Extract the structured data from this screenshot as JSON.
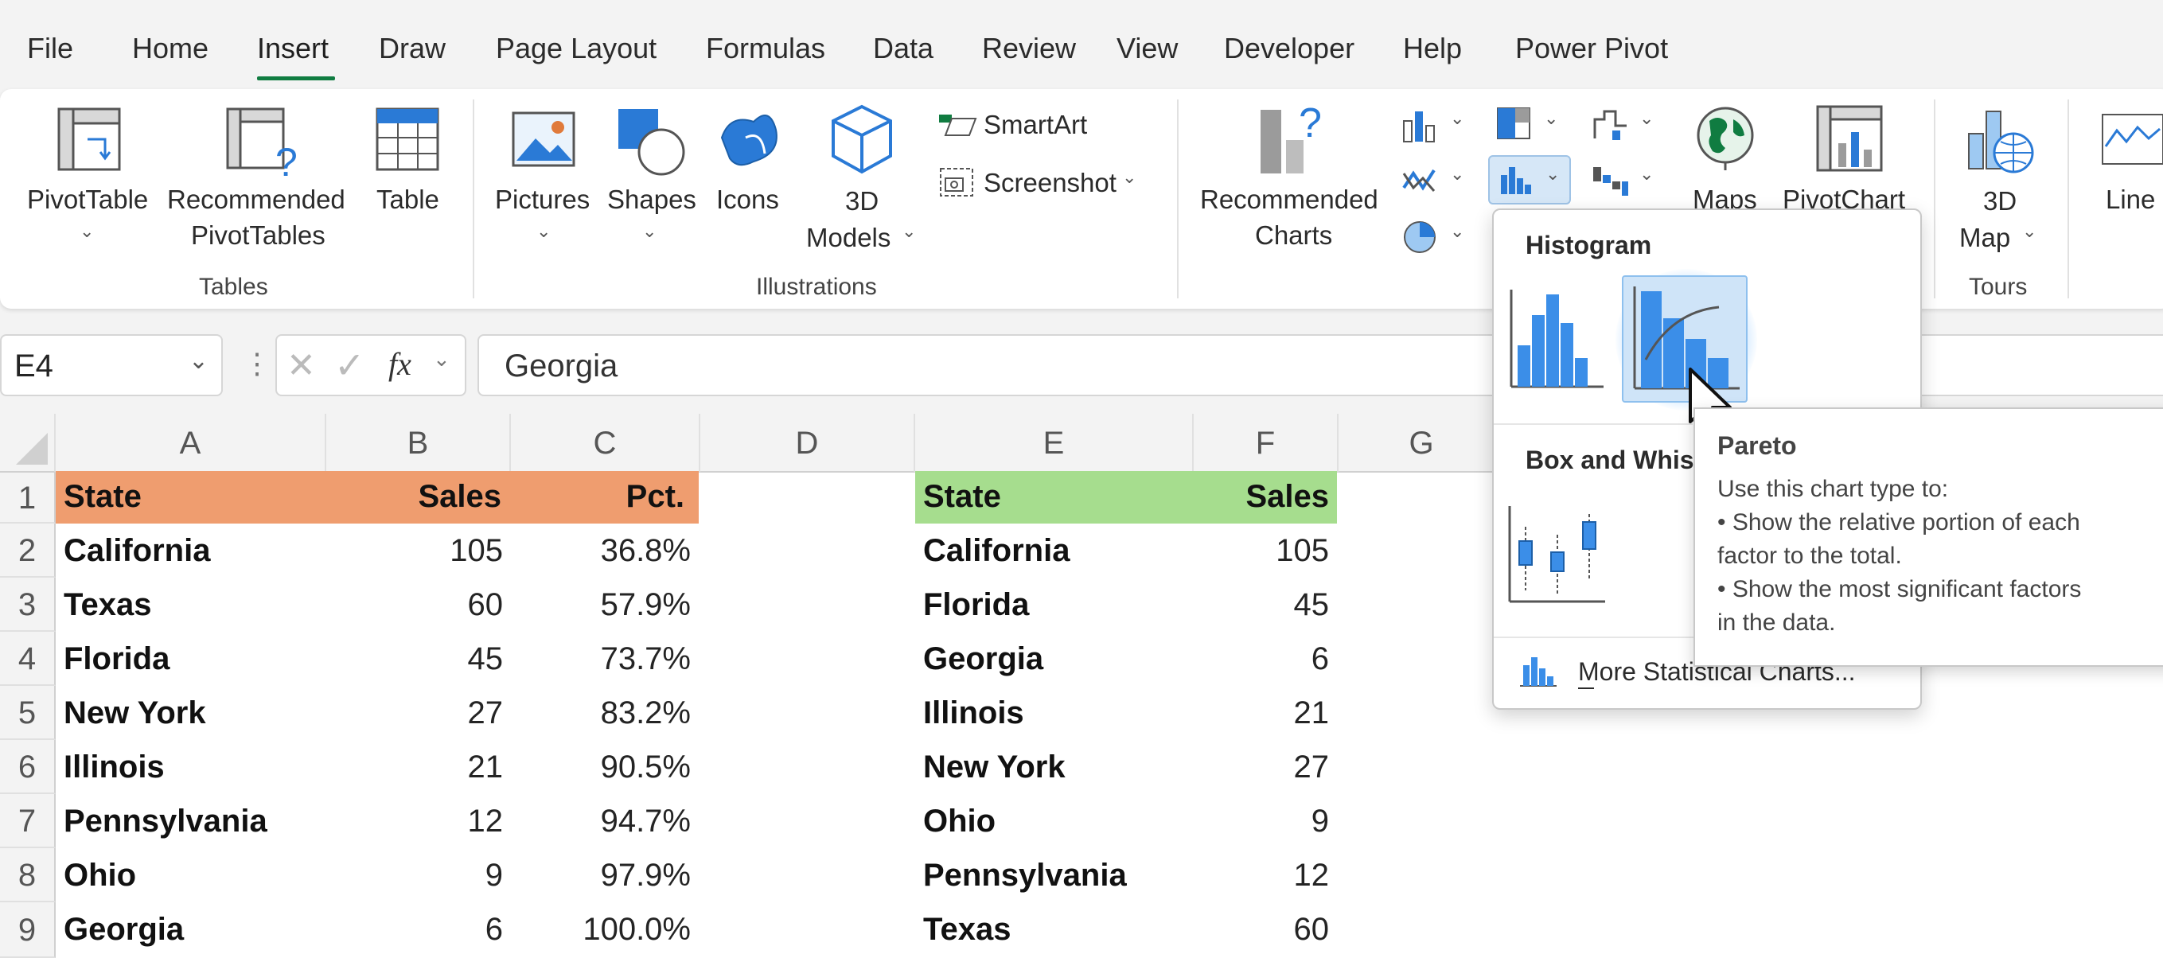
{
  "menu": {
    "tabs": [
      "File",
      "Home",
      "Insert",
      "Draw",
      "Page Layout",
      "Formulas",
      "Data",
      "Review",
      "View",
      "Developer",
      "Help",
      "Power Pivot"
    ],
    "active_tab": "Insert"
  },
  "ribbon": {
    "tables": {
      "group_label": "Tables",
      "pivot_table": "PivotTable",
      "recommended_1": "Recommended",
      "recommended_2": "PivotTables",
      "table": "Table"
    },
    "illustrations": {
      "group_label": "Illustrations",
      "pictures": "Pictures",
      "shapes": "Shapes",
      "icons": "Icons",
      "models_1": "3D",
      "models_2": "Models",
      "smartart": "SmartArt",
      "screenshot": "Screenshot"
    },
    "charts": {
      "recommended_1": "Recommended",
      "recommended_2": "Charts",
      "maps": "Maps",
      "pivot_chart": "PivotChart"
    },
    "tours": {
      "group_label": "Tours",
      "map_1": "3D",
      "map_2": "Map"
    },
    "sparklines": {
      "line": "Line"
    }
  },
  "formula_bar": {
    "name_box": "E4",
    "fx": "fx",
    "value": "Georgia"
  },
  "columns": [
    "A",
    "B",
    "C",
    "D",
    "E",
    "F",
    "G"
  ],
  "rows": [
    "1",
    "2",
    "3",
    "4",
    "5",
    "6",
    "7",
    "8",
    "9"
  ],
  "table_left": {
    "headers": [
      "State",
      "Sales",
      "Pct."
    ],
    "rows": [
      [
        "California",
        "105",
        "36.8%"
      ],
      [
        "Texas",
        "60",
        "57.9%"
      ],
      [
        "Florida",
        "45",
        "73.7%"
      ],
      [
        "New York",
        "27",
        "83.2%"
      ],
      [
        "Illinois",
        "21",
        "90.5%"
      ],
      [
        "Pennsylvania",
        "12",
        "94.7%"
      ],
      [
        "Ohio",
        "9",
        "97.9%"
      ],
      [
        "Georgia",
        "6",
        "100.0%"
      ]
    ]
  },
  "table_right": {
    "headers": [
      "State",
      "Sales"
    ],
    "rows": [
      [
        "California",
        "105"
      ],
      [
        "Florida",
        "45"
      ],
      [
        "Georgia",
        "6"
      ],
      [
        "Illinois",
        "21"
      ],
      [
        "New York",
        "27"
      ],
      [
        "Ohio",
        "9"
      ],
      [
        "Pennsylvania",
        "12"
      ],
      [
        "Texas",
        "60"
      ]
    ]
  },
  "dropdown": {
    "histogram_title": "Histogram",
    "box_whisker_title": "Box and Whis",
    "more_link": "More Statistical Charts..."
  },
  "tooltip": {
    "title": "Pareto",
    "lines": [
      "Use this chart type to:",
      "• Show the relative portion of each",
      "factor to the total.",
      "• Show the most significant factors",
      "in the data."
    ]
  },
  "colors": {
    "accent_green": "#107c41",
    "header_orange": "#ef9d6f",
    "header_green": "#a6dd8e",
    "chart_blue": "#3b8ee8"
  }
}
